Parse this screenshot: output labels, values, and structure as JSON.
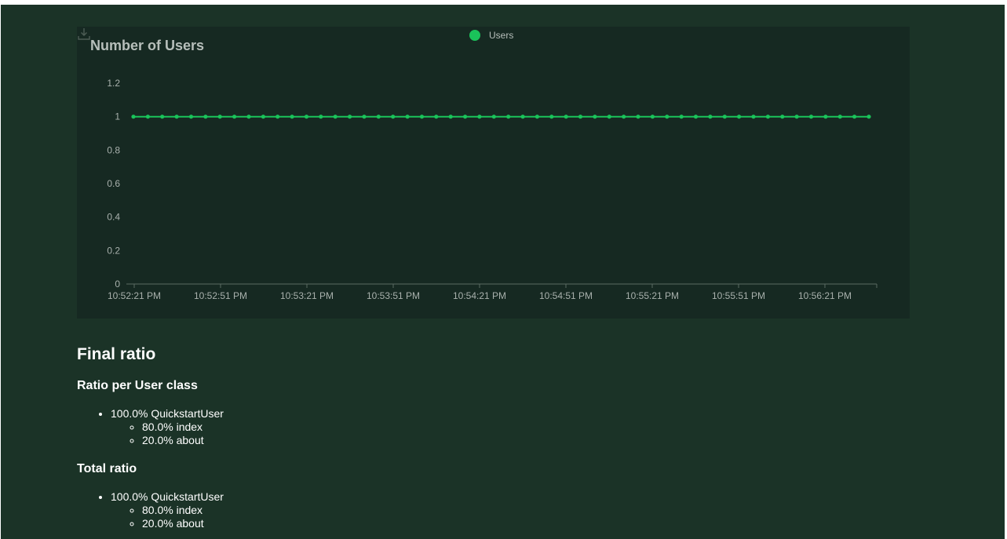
{
  "chart": {
    "title": "Number of Users",
    "legend": [
      {
        "label": "Users",
        "color": "#1ac35a"
      }
    ],
    "download_icon": "download-icon",
    "line_color": "#1ac35a"
  },
  "chart_data": {
    "type": "line",
    "title": "Number of Users",
    "xlabel": "",
    "ylabel": "",
    "ylim": [
      0,
      1.2
    ],
    "yticks": [
      "0",
      "0.2",
      "0.4",
      "0.6",
      "0.8",
      "1",
      "1.2"
    ],
    "xticks": [
      "10:52:21 PM",
      "10:52:51 PM",
      "10:53:21 PM",
      "10:53:51 PM",
      "10:54:21 PM",
      "10:54:51 PM",
      "10:55:21 PM",
      "10:55:51 PM",
      "10:56:21 PM"
    ],
    "x_start": "10:52:21 PM",
    "x_end": "10:56:31 PM",
    "series": [
      {
        "name": "Users",
        "color": "#1ac35a",
        "values": [
          1,
          1,
          1,
          1,
          1,
          1,
          1,
          1,
          1,
          1,
          1,
          1,
          1,
          1,
          1,
          1,
          1,
          1,
          1,
          1,
          1,
          1,
          1,
          1,
          1,
          1,
          1,
          1,
          1,
          1,
          1,
          1,
          1,
          1,
          1,
          1,
          1,
          1,
          1,
          1,
          1,
          1,
          1,
          1,
          1,
          1,
          1,
          1,
          1,
          1,
          1,
          1
        ]
      }
    ],
    "grid": false,
    "legend_position": "top-center"
  },
  "final_ratio": {
    "heading": "Final ratio",
    "per_class": {
      "heading": "Ratio per User class",
      "items": [
        {
          "label": "100.0% QuickstartUser",
          "children": [
            "80.0% index",
            "20.0% about"
          ]
        }
      ]
    },
    "total": {
      "heading": "Total ratio",
      "items": [
        {
          "label": "100.0% QuickstartUser",
          "children": [
            "80.0% index",
            "20.0% about"
          ]
        }
      ]
    }
  }
}
